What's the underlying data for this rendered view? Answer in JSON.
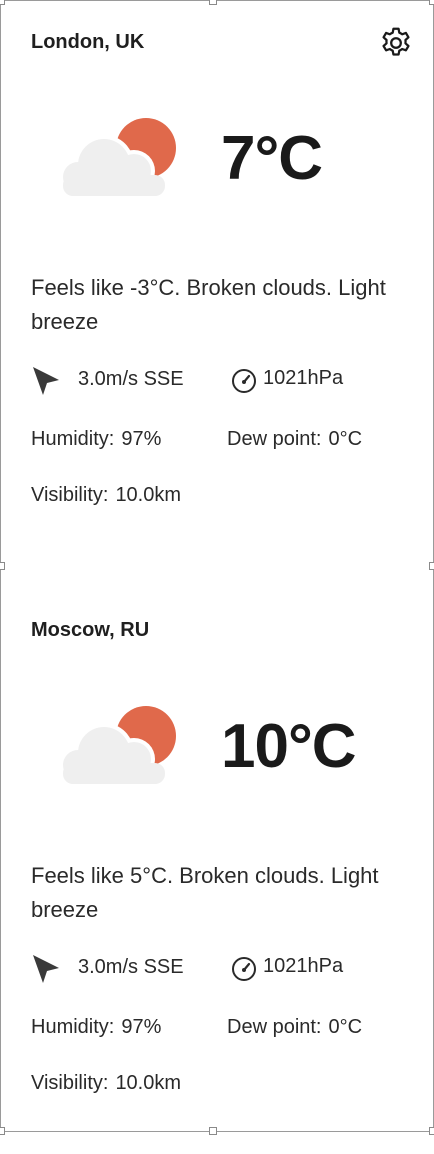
{
  "settings_icon": "gear-icon",
  "cards": [
    {
      "city": "London, UK",
      "weather_icon": "partly-cloudy-icon",
      "temperature": "7°C",
      "description": "Feels like -3°C. Broken clouds. Light breeze",
      "wind": "3.0m/s SSE",
      "pressure": "1021hPa",
      "humidity_label": "Humidity:",
      "humidity_value": "97%",
      "dew_label": "Dew point:",
      "dew_value": "0°C",
      "visibility_label": "Visibility:",
      "visibility_value": "10.0km"
    },
    {
      "city": "Moscow, RU",
      "weather_icon": "partly-cloudy-icon",
      "temperature": "10°C",
      "description": "Feels like 5°C. Broken clouds. Light breeze",
      "wind": "3.0m/s SSE",
      "pressure": "1021hPa",
      "humidity_label": "Humidity:",
      "humidity_value": "97%",
      "dew_label": "Dew point:",
      "dew_value": "0°C",
      "visibility_label": "Visibility:",
      "visibility_value": "10.0km"
    }
  ],
  "colors": {
    "sun": "#e0694b",
    "cloud": "#efefef",
    "text": "#1f1f1f",
    "icon": "#3a3a3a"
  }
}
